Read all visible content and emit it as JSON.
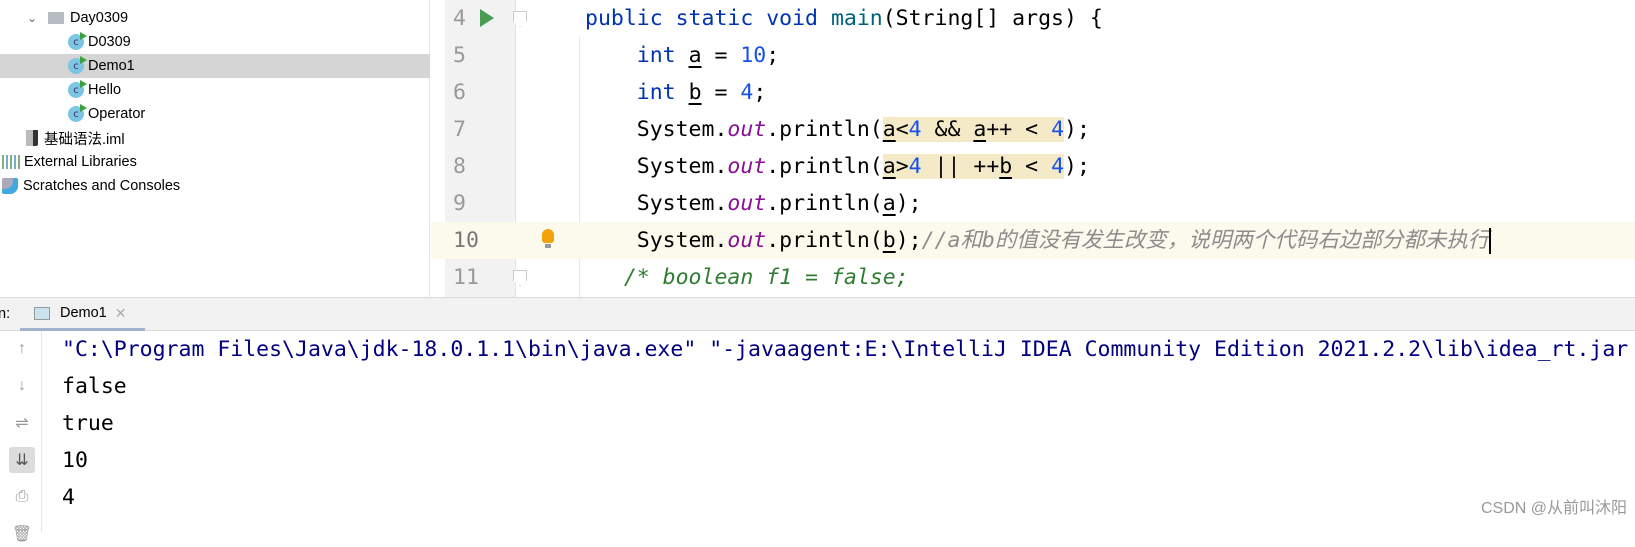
{
  "sidebar": {
    "items": [
      {
        "label": "Day0309",
        "type": "folder",
        "indent": 24
      },
      {
        "label": "D0309",
        "type": "class",
        "indent": 68
      },
      {
        "label": "Demo1",
        "type": "class",
        "indent": 68,
        "selected": true
      },
      {
        "label": "Hello",
        "type": "class",
        "indent": 68
      },
      {
        "label": "Operator",
        "type": "class",
        "indent": 68
      },
      {
        "label": "基础语法.iml",
        "type": "file",
        "indent": 26
      },
      {
        "label": "External Libraries",
        "type": "libraries",
        "indent": 2
      },
      {
        "label": "Scratches and Consoles",
        "type": "scratches",
        "indent": 2
      }
    ]
  },
  "editor": {
    "current_line": 10,
    "lines": [
      {
        "n": "4",
        "run": true,
        "fold": true,
        "tokens": [
          [
            "public static void ",
            "kw"
          ],
          [
            "main",
            "fn"
          ],
          [
            "(String[] args) {",
            ""
          ]
        ]
      },
      {
        "n": "5",
        "tokens": [
          [
            "    int ",
            "kw"
          ],
          [
            "a",
            "var"
          ],
          [
            " = ",
            ""
          ],
          [
            "10",
            "num"
          ],
          [
            ";",
            ""
          ]
        ]
      },
      {
        "n": "6",
        "tokens": [
          [
            "    int ",
            "kw"
          ],
          [
            "b",
            "var"
          ],
          [
            " = ",
            ""
          ],
          [
            "4",
            "num"
          ],
          [
            ";",
            ""
          ]
        ]
      },
      {
        "n": "7",
        "tokens": [
          [
            "    System.",
            ""
          ],
          [
            "out",
            "fld"
          ],
          [
            ".println(",
            ""
          ],
          [
            "a",
            "var hl"
          ],
          [
            "<",
            "hl"
          ],
          [
            "4",
            "num hl"
          ],
          [
            " && ",
            "hl"
          ],
          [
            "a",
            "var hl"
          ],
          [
            "++ < ",
            "hl"
          ],
          [
            "4",
            "num hl"
          ],
          [
            ");",
            ""
          ]
        ]
      },
      {
        "n": "8",
        "tokens": [
          [
            "    System.",
            ""
          ],
          [
            "out",
            "fld"
          ],
          [
            ".println(",
            ""
          ],
          [
            "a",
            "var hl"
          ],
          [
            ">",
            "hl"
          ],
          [
            "4",
            "num hl"
          ],
          [
            " || ++",
            "hl"
          ],
          [
            "b",
            "var hl"
          ],
          [
            " < ",
            "hl"
          ],
          [
            "4",
            "num hl"
          ],
          [
            ");",
            ""
          ]
        ]
      },
      {
        "n": "9",
        "tokens": [
          [
            "    System.",
            ""
          ],
          [
            "out",
            "fld"
          ],
          [
            ".println(",
            ""
          ],
          [
            "a",
            "var"
          ],
          [
            ");",
            ""
          ]
        ]
      },
      {
        "n": "10",
        "bulb": true,
        "tokens": [
          [
            "    System.",
            ""
          ],
          [
            "out",
            "fld"
          ],
          [
            ".println(",
            ""
          ],
          [
            "b",
            "var"
          ],
          [
            ");",
            ""
          ],
          [
            "//a和b的值没有发生改变，说明两个代码右边部分都未执行",
            "cmt"
          ]
        ]
      },
      {
        "n": "11",
        "fold": true,
        "tokens": [
          [
            "   /* boolean f1 = false;",
            "blk"
          ]
        ]
      }
    ]
  },
  "run_panel": {
    "label": "n:",
    "tab": "Demo1"
  },
  "console": {
    "lines": [
      "\"C:\\Program Files\\Java\\jdk-18.0.1.1\\bin\\java.exe\" \"-javaagent:E:\\IntelliJ IDEA Community Edition 2021.2.2\\lib\\idea_rt.jar",
      "false",
      "true",
      "10",
      "4"
    ],
    "tools": [
      "arrow-up-icon",
      "arrow-down-icon",
      "soft-wrap-icon",
      "scroll-to-end-icon",
      "print-icon",
      "trash-icon"
    ]
  },
  "watermark": "CSDN @从前叫沐阳"
}
